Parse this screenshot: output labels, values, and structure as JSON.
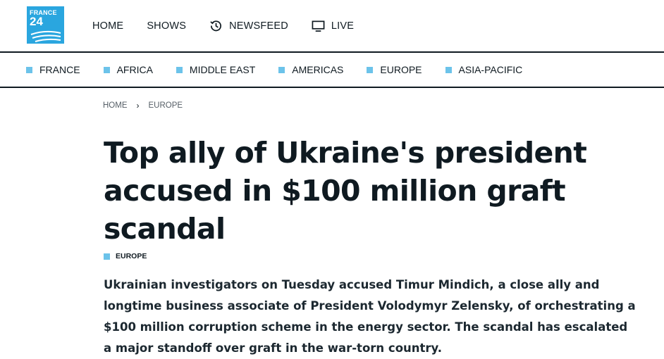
{
  "brand": {
    "line1": "FRANCE",
    "line2": "24"
  },
  "mainnav": [
    {
      "label": "HOME",
      "icon": null
    },
    {
      "label": "SHOWS",
      "icon": null
    },
    {
      "label": "NEWSFEED",
      "icon": "history-clock-icon"
    },
    {
      "label": "LIVE",
      "icon": "monitor-icon"
    }
  ],
  "categories": [
    "FRANCE",
    "AFRICA",
    "MIDDLE EAST",
    "AMERICAS",
    "EUROPE",
    "ASIA-PACIFIC"
  ],
  "breadcrumb": {
    "home": "HOME",
    "section": "EUROPE"
  },
  "article": {
    "headline": "Top ally of Ukraine's president accused in $100 million graft scandal",
    "tag": "EUROPE",
    "lead": "Ukrainian investigators on Tuesday accused Timur Mindich, a close ally and longtime business associate of President Volodymyr Zelensky, of orchestrating a $100 million corruption scheme in the energy sector. The scandal has escalated a major standoff over graft in the war-torn country."
  },
  "colors": {
    "accent": "#6cc3ea",
    "logo_bg": "#2aa6df",
    "text": "#0f1a21"
  }
}
